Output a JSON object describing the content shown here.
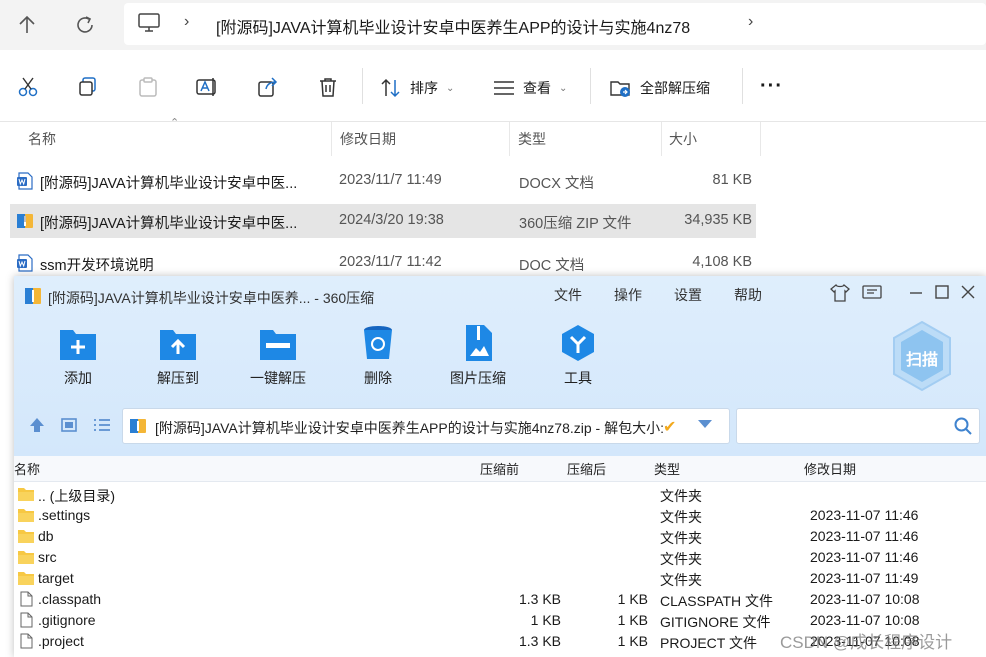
{
  "explorer": {
    "breadcrumb_current": "[附源码]JAVA计算机毕业设计安卓中医养生APP的设计与实施4nz78",
    "toolbar": {
      "sort_label": "排序",
      "view_label": "查看",
      "extract_all_label": "全部解压缩"
    },
    "columns": {
      "name": "名称",
      "modified": "修改日期",
      "type": "类型",
      "size": "大小"
    },
    "files": [
      {
        "name": "[附源码]JAVA计算机毕业设计安卓中医...",
        "modified": "2023/11/7 11:49",
        "type": "DOCX 文档",
        "size": "81 KB",
        "icon": "word-icon"
      },
      {
        "name": "[附源码]JAVA计算机毕业设计安卓中医...",
        "modified": "2024/3/20 19:38",
        "type": "360压缩 ZIP 文件",
        "size": "34,935 KB",
        "icon": "zip-icon"
      },
      {
        "name": "ssm开发环境说明",
        "modified": "2023/11/7 11:42",
        "type": "DOC 文档",
        "size": "4,108 KB",
        "icon": "word-icon"
      }
    ]
  },
  "zip_window": {
    "title": "[附源码]JAVA计算机毕业设计安卓中医养... - 360压缩",
    "menu": [
      "文件",
      "操作",
      "设置",
      "帮助"
    ],
    "actions": [
      {
        "label": "添加",
        "icon": "add-icon"
      },
      {
        "label": "解压到",
        "icon": "extract-to-icon"
      },
      {
        "label": "一键解压",
        "icon": "quick-extract-icon"
      },
      {
        "label": "删除",
        "icon": "delete-icon"
      },
      {
        "label": "图片压缩",
        "icon": "image-compress-icon"
      },
      {
        "label": "工具",
        "icon": "tools-icon"
      }
    ],
    "scan_label": "扫描",
    "path": "[附源码]JAVA计算机毕业设计安卓中医养生APP的设计与实施4nz78.zip - 解包大小:",
    "columns": {
      "name": "名称",
      "before": "压缩前",
      "after": "压缩后",
      "type": "类型",
      "modified": "修改日期"
    },
    "entries": [
      {
        "name": ".. (上级目录)",
        "before": "",
        "after": "",
        "type": "文件夹",
        "modified": "",
        "kind": "folder"
      },
      {
        "name": ".settings",
        "before": "",
        "after": "",
        "type": "文件夹",
        "modified": "2023-11-07 11:46",
        "kind": "folder"
      },
      {
        "name": "db",
        "before": "",
        "after": "",
        "type": "文件夹",
        "modified": "2023-11-07 11:46",
        "kind": "folder"
      },
      {
        "name": "src",
        "before": "",
        "after": "",
        "type": "文件夹",
        "modified": "2023-11-07 11:46",
        "kind": "folder"
      },
      {
        "name": "target",
        "before": "",
        "after": "",
        "type": "文件夹",
        "modified": "2023-11-07 11:49",
        "kind": "folder"
      },
      {
        "name": ".classpath",
        "before": "1.3 KB",
        "after": "1 KB",
        "type": "CLASSPATH 文件",
        "modified": "2023-11-07 10:08",
        "kind": "file"
      },
      {
        "name": ".gitignore",
        "before": "1 KB",
        "after": "1 KB",
        "type": "GITIGNORE 文件",
        "modified": "2023-11-07 10:08",
        "kind": "file"
      },
      {
        "name": ".project",
        "before": "1.3 KB",
        "after": "1 KB",
        "type": "PROJECT 文件",
        "modified": "2023-11-07 10:08",
        "kind": "file"
      }
    ]
  },
  "watermark": "CSDN @成长程序设计",
  "colors": {
    "accent_blue": "#1e88e5",
    "folder_yellow": "#f7c843",
    "selection": "#e5e5e5"
  }
}
